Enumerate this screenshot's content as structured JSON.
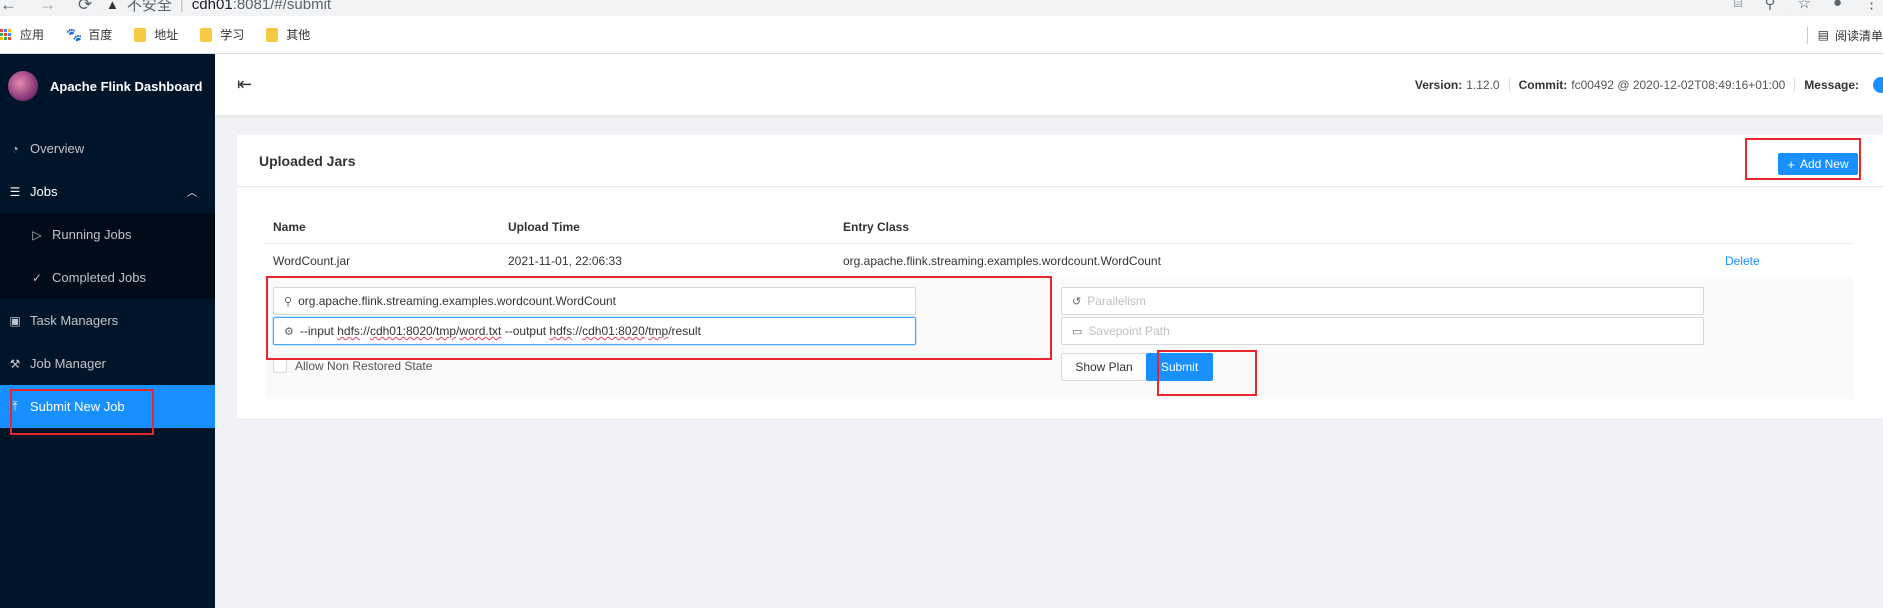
{
  "browser": {
    "back": "←",
    "forward": "→",
    "reload": "⟳",
    "security_warning": "不安全",
    "url_host": "cdh01",
    "url_path": ":8081/#/submit",
    "bookmarks": [
      {
        "label": "应用",
        "icon": "apps-grid-icon"
      },
      {
        "label": "百度",
        "icon": "baidu-paw-icon"
      },
      {
        "label": "地址",
        "icon": "folder-icon"
      },
      {
        "label": "学习",
        "icon": "folder-icon"
      },
      {
        "label": "其他",
        "icon": "folder-icon"
      }
    ],
    "reading_list": "阅读清单"
  },
  "sidebar": {
    "title": "Apache Flink Dashboard",
    "items": [
      {
        "label": "Overview",
        "icon": "dashboard-icon"
      },
      {
        "label": "Jobs",
        "icon": "list-icon"
      },
      {
        "label": "Running Jobs",
        "icon": "play-circle-icon"
      },
      {
        "label": "Completed Jobs",
        "icon": "check-circle-icon"
      },
      {
        "label": "Task Managers",
        "icon": "schedule-icon"
      },
      {
        "label": "Job Manager",
        "icon": "build-icon"
      },
      {
        "label": "Submit New Job",
        "icon": "upload-icon"
      }
    ]
  },
  "header": {
    "version_label": "Version:",
    "version_value": "1.12.0",
    "commit_label": "Commit:",
    "commit_value": "fc00492 @ 2020-12-02T08:49:16+01:00",
    "message_label": "Message:"
  },
  "card": {
    "title": "Uploaded Jars",
    "add_button": "Add New",
    "columns": [
      "Name",
      "Upload Time",
      "Entry Class"
    ],
    "rows": [
      {
        "name": "WordCount.jar",
        "upload_time": "2021-11-01, 22:06:33",
        "entry_class": "org.apache.flink.streaming.examples.wordcount.WordCount",
        "action": "Delete"
      }
    ],
    "form": {
      "entry_class_value": "org.apache.flink.streaming.examples.wordcount.WordCount",
      "args": {
        "p1": "--input ",
        "p2": "hdfs",
        "p3": "://",
        "p4": "cdh01:8020",
        "p5": "/",
        "p6": "tmp",
        "p7": "/",
        "p8": "word.txt",
        "p9": " --output ",
        "p10": "hdfs",
        "p11": "://",
        "p12": "cdh01:8020",
        "p13": "/",
        "p14": "tmp",
        "p15": "/result"
      },
      "parallelism_placeholder": "Parallelism",
      "savepoint_placeholder": "Savepoint Path",
      "allow_non_restored": "Allow Non Restored State",
      "show_plan": "Show Plan",
      "submit": "Submit"
    }
  },
  "colors": {
    "sidebar_bg": "#001529",
    "primary": "#1890ff",
    "highlight_box": "#e8262b"
  }
}
